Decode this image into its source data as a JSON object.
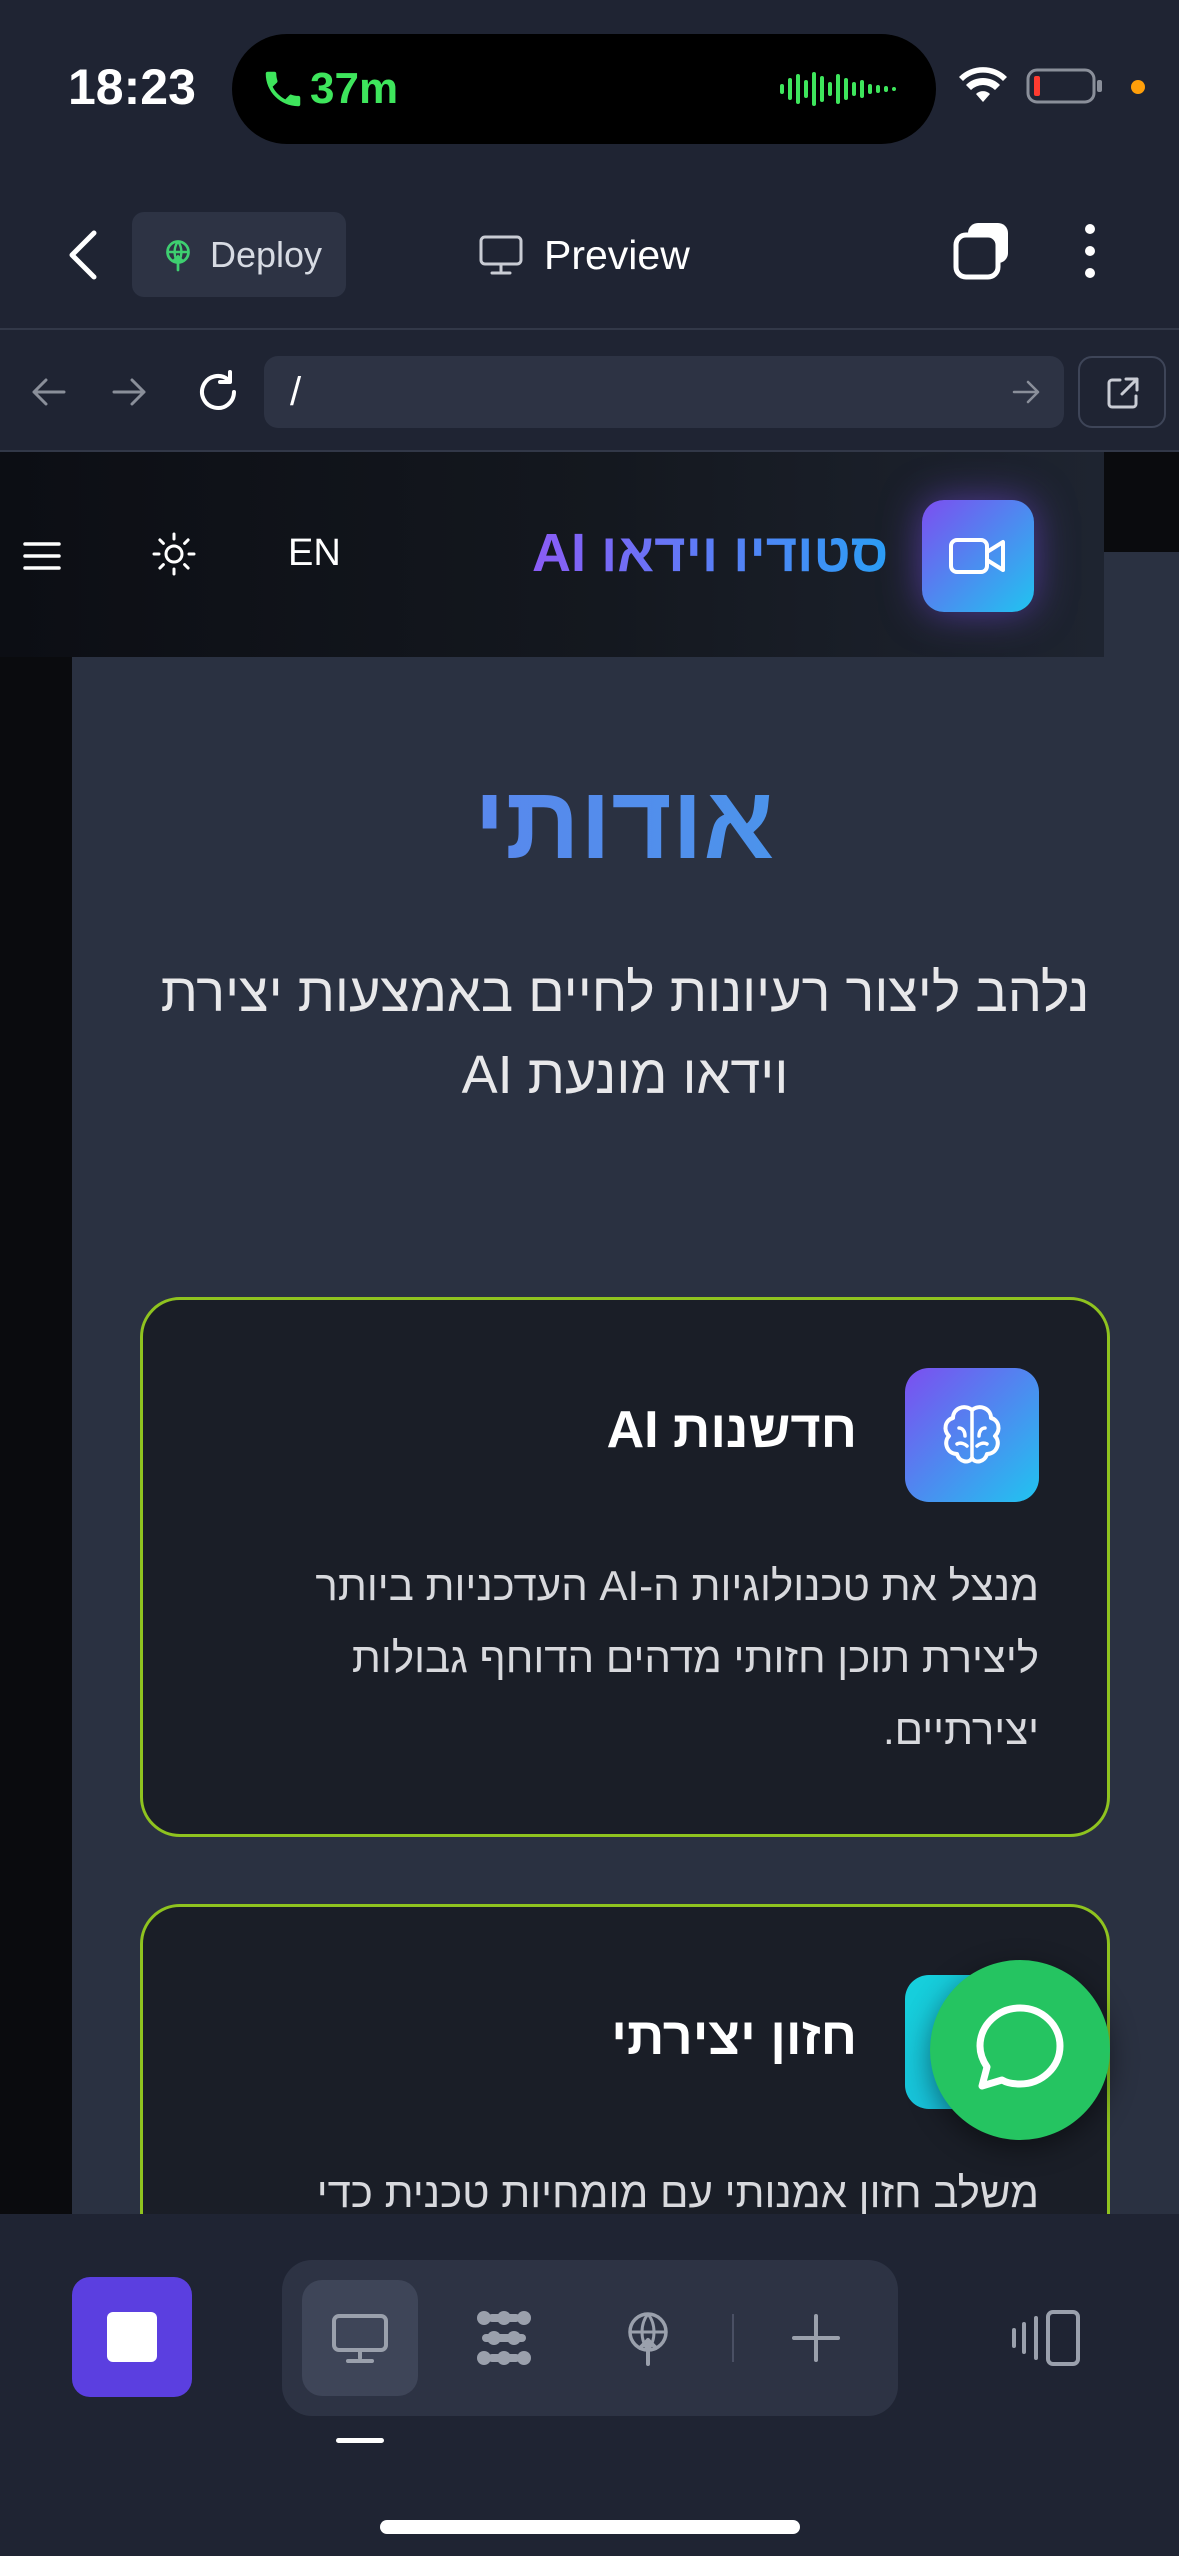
{
  "status_bar": {
    "time": "18:23",
    "call_duration": "37m"
  },
  "toolbar": {
    "deploy_label": "Deploy",
    "preview_label": "Preview"
  },
  "url_bar": {
    "url": "/"
  },
  "site": {
    "lang_toggle": "EN",
    "brand_name": "סטודיו וידאו AI",
    "about_title": "אודותי",
    "about_subtitle": "נלהב ליצור רעיונות לחיים באמצעות יצירת וידאו מונעת AI",
    "cards": [
      {
        "title": "חדשנות AI",
        "body": "מנצל את טכנולוגיות ה-AI העדכניות ביותר ליצירת תוכן חזותי מדהים הדוחף גבולות יצירתיים.",
        "icon": "brain-icon"
      },
      {
        "title": "חזון יצירתי",
        "body": "משלב חזון אמנותי עם מומחיות טכנית כדי",
        "icon": "vision-icon"
      }
    ]
  },
  "colors": {
    "accent_purple": "#5b3fe0",
    "card_border": "#8fc31f",
    "whatsapp_green": "#25c461",
    "call_green": "#3ee55c"
  }
}
